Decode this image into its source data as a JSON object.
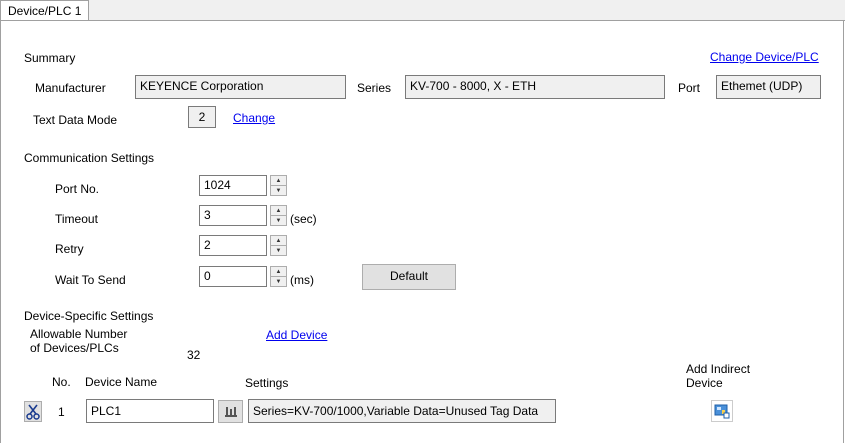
{
  "tab": {
    "label": "Device/PLC 1"
  },
  "summary": {
    "heading": "Summary",
    "change_link": "Change Device/PLC",
    "manufacturer_label": "Manufacturer",
    "manufacturer_value": "KEYENCE Corporation",
    "series_label": "Series",
    "series_value": "KV-700 - 8000, X - ETH",
    "port_label": "Port",
    "port_value": "Ethemet (UDP)",
    "text_mode_label": "Text Data Mode",
    "text_mode_value": "2",
    "text_mode_change": "Change"
  },
  "comm": {
    "heading": "Communication Settings",
    "port_label": "Port No.",
    "port_value": "1024",
    "timeout_label": "Timeout",
    "timeout_value": "3",
    "timeout_unit": "(sec)",
    "retry_label": "Retry",
    "retry_value": "2",
    "wait_label": "Wait To Send",
    "wait_value": "0",
    "wait_unit": "(ms)",
    "default_button": "Default"
  },
  "device_specific": {
    "heading": "Device-Specific Settings",
    "allowable_line1": "Allowable Number",
    "allowable_line2": "of Devices/PLCs",
    "allowable_value": "32",
    "add_device_link": "Add Device",
    "col_no": "No.",
    "col_name": "Device Name",
    "col_settings": "Settings",
    "col_indirect_line1": "Add Indirect",
    "col_indirect_line2": "Device",
    "rows": [
      {
        "no": "1",
        "name": "PLC1",
        "settings": "Series=KV-700/1000,Variable Data=Unused Tag Data"
      }
    ]
  },
  "icons": {
    "delete": "scissors-icon",
    "settings": "device-settings-icon",
    "indirect": "add-indirect-device-icon"
  }
}
